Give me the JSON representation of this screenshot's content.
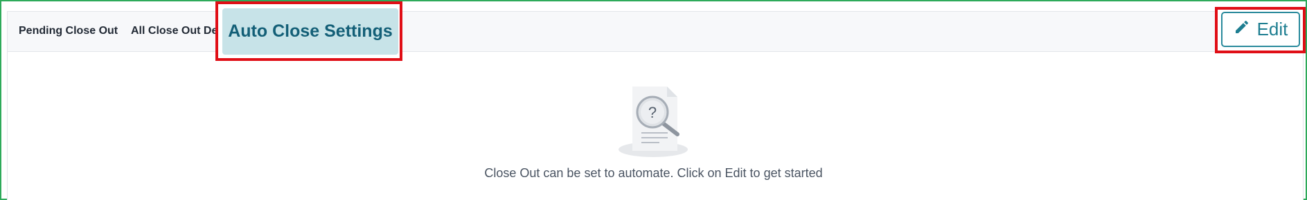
{
  "tabs": {
    "pending": "Pending Close Out",
    "all": "All Close Out Details",
    "auto": "Auto Close Settings"
  },
  "toolbar": {
    "edit_label": "Edit",
    "edit_icon": "pencil-icon"
  },
  "empty_state": {
    "icon": "document-search-icon",
    "message": "Close Out can be set to automate. Click on Edit to get started"
  },
  "colors": {
    "highlight": "#e00e16",
    "accent": "#1e7e91",
    "active_tab_bg": "#c7e3e8",
    "frame": "#2eaa5a"
  }
}
